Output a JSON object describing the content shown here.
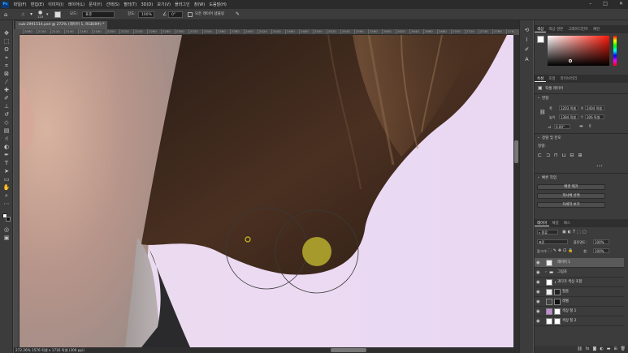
{
  "menubar": {
    "logo": "Ps",
    "items": [
      "파일(F)",
      "편집(E)",
      "이미지(I)",
      "레이어(L)",
      "문자(Y)",
      "선택(S)",
      "필터(T)",
      "3D(D)",
      "보기(V)",
      "플러그인",
      "창(W)",
      "도움말(H)"
    ],
    "window_controls": [
      "–",
      "□",
      "✕"
    ]
  },
  "options": {
    "mode_label": "모드:",
    "mode_value": "표준",
    "brush_size": "125",
    "strength_label": "강도:",
    "strength_value": "100%",
    "angle_value": "0°",
    "sample_all_layers": "모든 레이어 샘플링"
  },
  "document": {
    "tab_title": "sub-2991514.psd @ 272% (레이어 1, RGB/8#) *",
    "status": "272.26%   1576 픽셀 x 1716 픽셀 (300 ppi)"
  },
  "ruler": {
    "labels": [
      "2080",
      "2100",
      "2120",
      "2140",
      "2160",
      "2180",
      "2200",
      "2220",
      "2240",
      "2260",
      "2280",
      "2300",
      "2320",
      "2340",
      "2360",
      "2380",
      "2400",
      "2420",
      "2440",
      "2460",
      "2480",
      "2500",
      "2520",
      "2540",
      "2560",
      "2580",
      "2600",
      "2620",
      "2640",
      "2660",
      "2680",
      "2700",
      "2720",
      "2740",
      "2760",
      "2780",
      "2800"
    ]
  },
  "color_panel": {
    "tabs": [
      "색상",
      "색상 견본",
      "그레이디언트",
      "패턴"
    ],
    "hue_color": "#ff1a0a"
  },
  "properties_panel": {
    "tabs": [
      "속성",
      "조정",
      "라이브러리"
    ],
    "layer_type": "픽셀 레이어",
    "transform_header": "변형",
    "w_label": "폭",
    "w_value": "1203 픽셀",
    "x_label": "X",
    "x_value": "2404 픽셀",
    "h_label": "높이",
    "h_value": "1384 픽셀",
    "y_label": "Y",
    "y_value": "306 픽셀",
    "angle_value": "0.00°",
    "align_header": "정렬 및 분포",
    "align_label": "정렬:",
    "more": "•••",
    "quick_actions_header": "빠른 작업",
    "buttons": [
      "배경 제거",
      "피사체 선택",
      "자세히 보기"
    ]
  },
  "layers_panel": {
    "tabs": [
      "레이어",
      "채널",
      "패스"
    ],
    "filter_label": "종류",
    "blend_mode": "표준",
    "opacity_label": "불투명도:",
    "opacity_value": "100%",
    "lock_label": "잠그기:",
    "fill_label": "칠:",
    "fill_value": "100%",
    "layers": [
      {
        "name": "레이어 1",
        "selected": true
      },
      {
        "name": "그림자",
        "selected": false
      },
      {
        "name": "과다가 색상 조합",
        "selected": false
      },
      {
        "name": "필름",
        "selected": false
      },
      {
        "name": "레벨",
        "selected": false
      },
      {
        "name": "색상 칠 1",
        "selected": false
      },
      {
        "name": "색상 칠 2",
        "selected": false
      }
    ],
    "footer_icons": [
      "link-icon",
      "fx-icon",
      "mask-icon",
      "adjustment-icon",
      "folder-icon",
      "new-layer-icon",
      "trash-icon"
    ]
  }
}
